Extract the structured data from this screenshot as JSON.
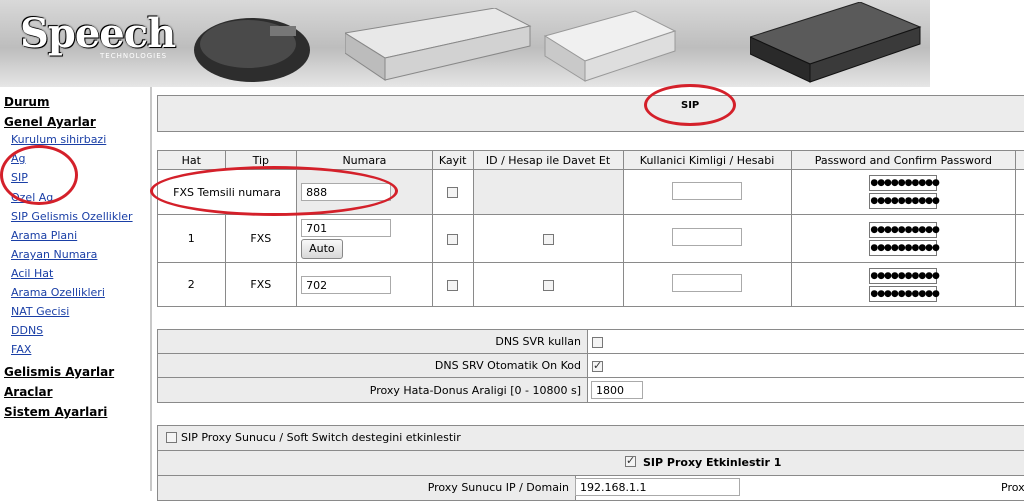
{
  "header": {
    "logo_text": "Speech",
    "logo_sub": "TECHNOLOGIES"
  },
  "nav": {
    "durum": "Durum",
    "genel": "Genel Ayarlar",
    "sub_items": [
      "Kurulum sihirbazi",
      "Ag",
      "SIP",
      "Ozel Ag",
      "SIP Gelismis Ozellikler",
      "Arama Plani",
      "Arayan Numara",
      "Acil Hat",
      "Arama Ozellikleri",
      "NAT Gecisi",
      "DDNS",
      "FAX"
    ],
    "gelismis": "Gelismis Ayarlar",
    "araclar": "Araclar",
    "sistem": "Sistem Ayarlari"
  },
  "page": {
    "title": "SIP"
  },
  "lines_table": {
    "headers": [
      "Hat",
      "Tip",
      "Numara",
      "Kayit",
      "ID / Hesap ile Davet Et",
      "Kullanici Kimligi / Hesabi",
      "Password and Confirm Password"
    ],
    "rep_label": "FXS Temsili numara",
    "rep_number": "888",
    "rows": [
      {
        "hat": "1",
        "tip": "FXS",
        "numara": "701",
        "auto": "Auto"
      },
      {
        "hat": "2",
        "tip": "FXS",
        "numara": "702"
      }
    ],
    "password_mask": "●●●●●●●●●●"
  },
  "dns": {
    "svr_label": "DNS SVR kullan",
    "srv_prefix_label": "DNS SRV Otomatik On Kod",
    "proxy_fallback_label": "Proxy Hata-Donus Araligi [0 - 10800 s]",
    "proxy_fallback_value": "1800"
  },
  "proxy": {
    "enable_softswitch_label": "SIP Proxy Sunucu / Soft Switch destegini etkinlestir",
    "proxy1_label": "SIP Proxy Etkinlestir 1",
    "server_label": "Proxy Sunucu IP / Domain",
    "server_value": "192.168.1.1",
    "right_label": "Prox"
  },
  "colors": {
    "annotation": "#d4202a",
    "link": "#1a3fa6"
  }
}
